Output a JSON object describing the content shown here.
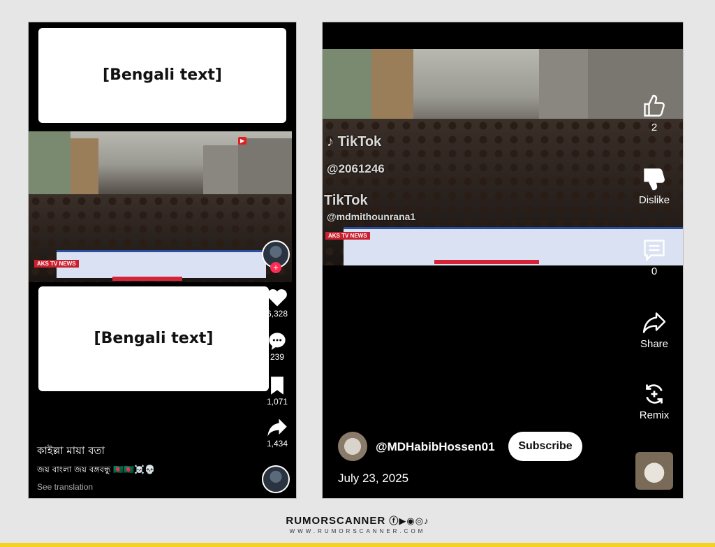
{
  "left_post": {
    "top_caption": "[Bengali text]",
    "mid_caption": "[Bengali text]",
    "video_watermark": "AKS TV NEWS",
    "actions": [
      {
        "icon": "heart-icon",
        "count": "6,328"
      },
      {
        "icon": "comment-icon",
        "count": "239"
      },
      {
        "icon": "bookmark-icon",
        "count": "1,071"
      },
      {
        "icon": "share-icon",
        "count": "1,434"
      }
    ],
    "username": "কাইল্লা মায়া বতা",
    "description": "জয় বাংলা জয় বঙ্গবন্ধু 🇧🇩🇧🇩☠️💀",
    "see_translation": "See translation"
  },
  "right_post": {
    "tiktok_label": "TikTok",
    "tiktok_id": "@2061246",
    "tiktok_label2": "TikTok",
    "tiktok_user": "@mdmithounrana1",
    "video_watermark": "AKS TV NEWS",
    "actions": [
      {
        "icon": "like-icon",
        "label": "2"
      },
      {
        "icon": "dislike-icon",
        "label": "Dislike"
      },
      {
        "icon": "comment-icon",
        "label": "0"
      },
      {
        "icon": "share-icon",
        "label": "Share"
      },
      {
        "icon": "remix-icon",
        "label": "Remix"
      }
    ],
    "channel_name": "@MDHabibHossen01",
    "subscribe_label": "Subscribe",
    "date": "July 23, 2025"
  },
  "footer": {
    "brand": "RUMORSCANNER",
    "site": "WWW.RUMORSCANNER.COM"
  },
  "colors": {
    "accent_yellow": "#f4d21f",
    "panel_bg": "#000000",
    "page_bg": "#e6e6e6"
  }
}
